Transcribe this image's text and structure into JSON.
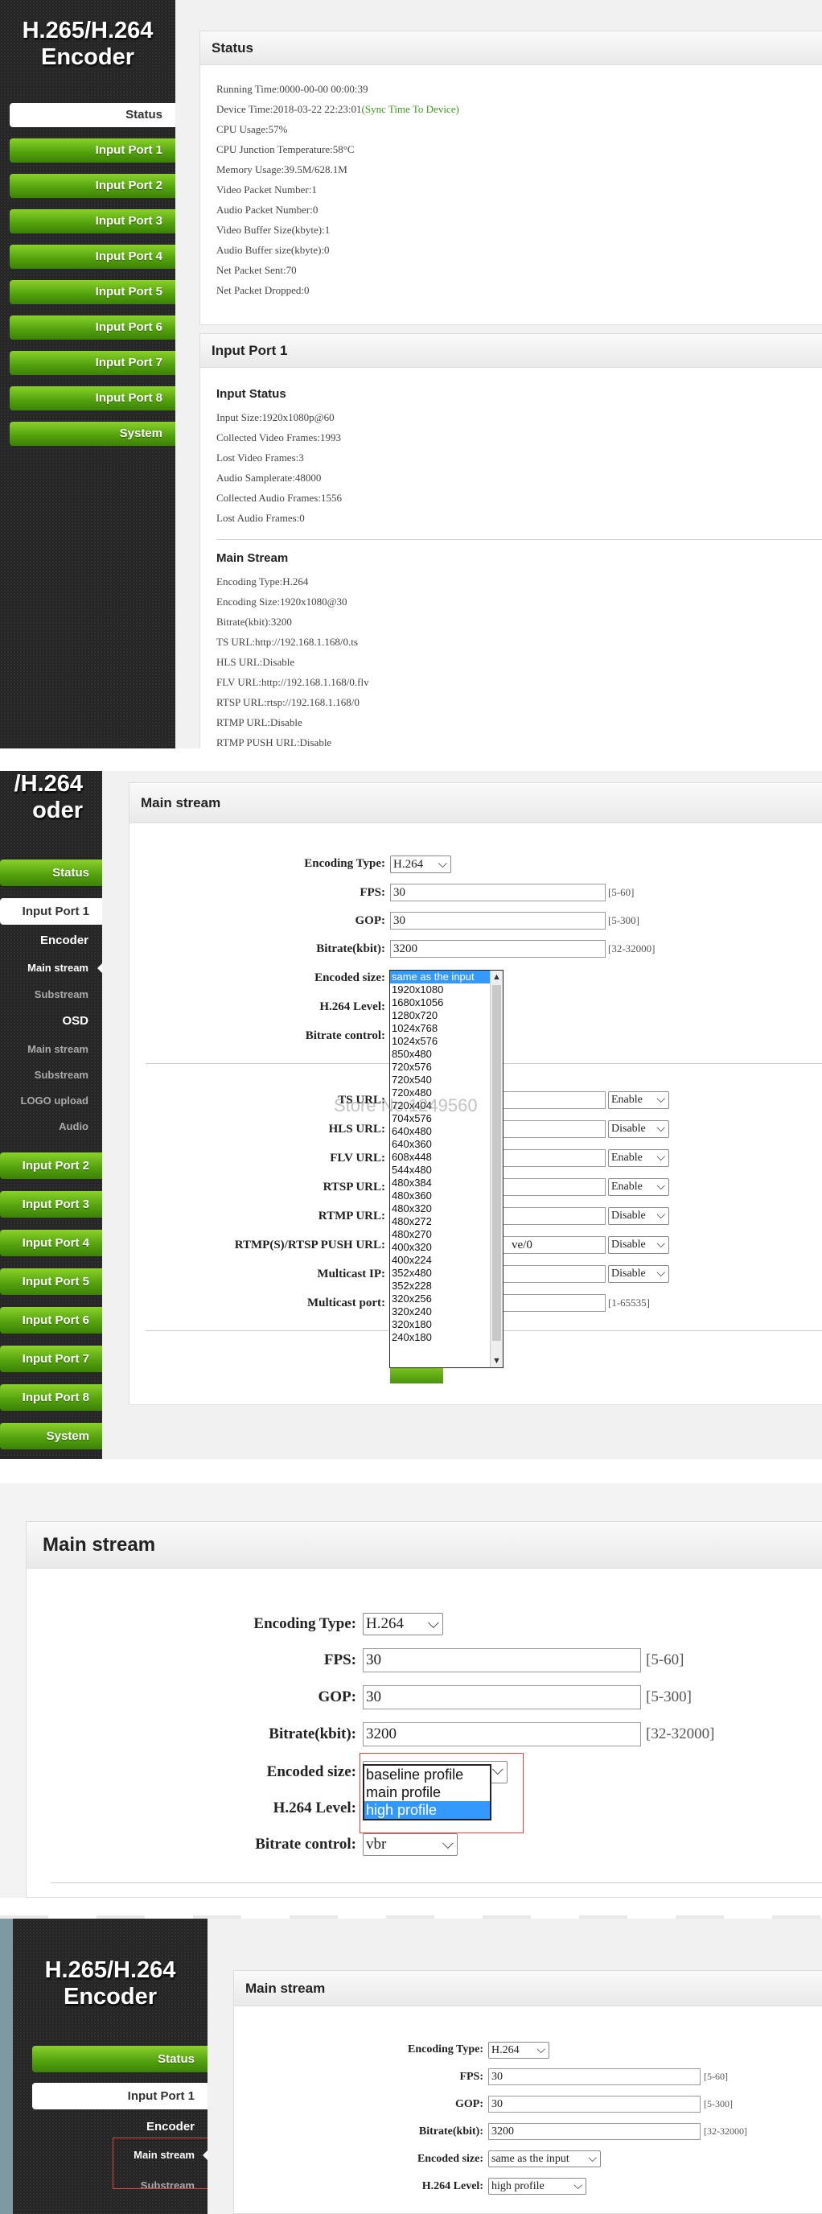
{
  "brand": {
    "line1": "H.265/H.264",
    "line2": "Encoder",
    "partial1": "/H.264",
    "partial2": "oder"
  },
  "nav": {
    "status": "Status",
    "ports": [
      "Input Port 1",
      "Input Port 2",
      "Input Port 3",
      "Input Port 4",
      "Input Port 5",
      "Input Port 6",
      "Input Port 7",
      "Input Port 8"
    ],
    "system": "System",
    "encoder": "Encoder",
    "main_stream": "Main stream",
    "substream": "Substream",
    "osd": "OSD",
    "osd_main": "Main stream",
    "osd_sub": "Substream",
    "logo_upload": "LOGO upload",
    "audio": "Audio"
  },
  "status": {
    "title": "Status",
    "running_time": "Running Time:0000-00-00 00:00:39",
    "device_time": "Device Time:2018-03-22 22:23:01",
    "sync_link": "(Sync Time To Device)",
    "cpu_usage": "CPU Usage:57%",
    "cpu_temp": "CPU Junction Temperature:58°C",
    "memory": "Memory Usage:39.5M/628.1M",
    "video_packets": "Video Packet Number:1",
    "audio_packets": "Audio Packet Number:0",
    "video_buffer": "Video Buffer Size(kbyte):1",
    "audio_buffer": "Audio Buffer size(kbyte):0",
    "net_sent": "Net Packet Sent:70",
    "net_dropped": "Net Packet Dropped:0"
  },
  "port1": {
    "title": "Input Port 1",
    "input_status": "Input Status",
    "input_size": "Input Size:1920x1080p@60",
    "collected_video": "Collected Video Frames:1993",
    "lost_video": "Lost Video Frames:3",
    "audio_samplerate": "Audio Samplerate:48000",
    "collected_audio": "Collected Audio Frames:1556",
    "lost_audio": "Lost Audio Frames:0",
    "main_stream": "Main Stream",
    "encoding_type": "Encoding Type:H.264",
    "encoding_size": "Encoding Size:1920x1080@30",
    "bitrate": "Bitrate(kbit):3200",
    "ts_url": "TS URL:http://192.168.1.168/0.ts",
    "hls_url": "HLS URL:Disable",
    "flv_url": "FLV URL:http://192.168.1.168/0.flv",
    "rtsp_url": "RTSP URL:rtsp://192.168.1.168/0",
    "rtmp_url": "RTMP URL:Disable",
    "rtmp_push": "RTMP PUSH URL:Disable"
  },
  "form": {
    "title": "Main stream",
    "encoding_type_label": "Encoding Type:",
    "encoding_type_value": "H.264",
    "fps_label": "FPS:",
    "fps_value": "30",
    "fps_range": "[5-60]",
    "gop_label": "GOP:",
    "gop_value": "30",
    "gop_range": "[5-300]",
    "bitrate_label": "Bitrate(kbit):",
    "bitrate_value": "3200",
    "bitrate_range": "[32-32000]",
    "encoded_size_label": "Encoded size:",
    "encoded_size_value": "same as the input",
    "h264_level_label": "H.264 Level:",
    "h264_level_value": "high profile",
    "bitrate_control_label": "Bitrate control:",
    "bitrate_control_value": "vbr",
    "ts_label": "TS URL:",
    "ts_state": "Enable",
    "hls_label": "HLS URL:",
    "hls_state": "Disable",
    "flv_label": "FLV URL:",
    "flv_state": "Enable",
    "rtsp_label": "RTSP URL:",
    "rtsp_state": "Enable",
    "rtmp_label": "RTMP URL:",
    "rtmp_state": "Disable",
    "push_label": "RTMP(S)/RTSP PUSH URL:",
    "push_value": "ve/0",
    "push_state": "Disable",
    "multicast_ip_label": "Multicast IP:",
    "multicast_state": "Disable",
    "multicast_port_label": "Multicast port:",
    "multicast_port_range": "[1-65535]"
  },
  "size_options": [
    "same as the input",
    "1920x1080",
    "1680x1056",
    "1280x720",
    "1024x768",
    "1024x576",
    "850x480",
    "720x576",
    "720x540",
    "720x480",
    "720x404",
    "704x576",
    "640x480",
    "640x360",
    "608x448",
    "544x480",
    "480x384",
    "480x360",
    "480x320",
    "480x272",
    "480x270",
    "400x320",
    "400x224",
    "352x480",
    "352x228",
    "320x256",
    "320x240",
    "320x180",
    "240x180"
  ],
  "profile_options": [
    "baseline profile",
    "main profile",
    "high profile"
  ],
  "watermark": "Store No.1249560",
  "colors": {
    "accent_green": "#5aa915",
    "select_blue": "#3399ff",
    "sync_green": "#3a9a1a"
  }
}
